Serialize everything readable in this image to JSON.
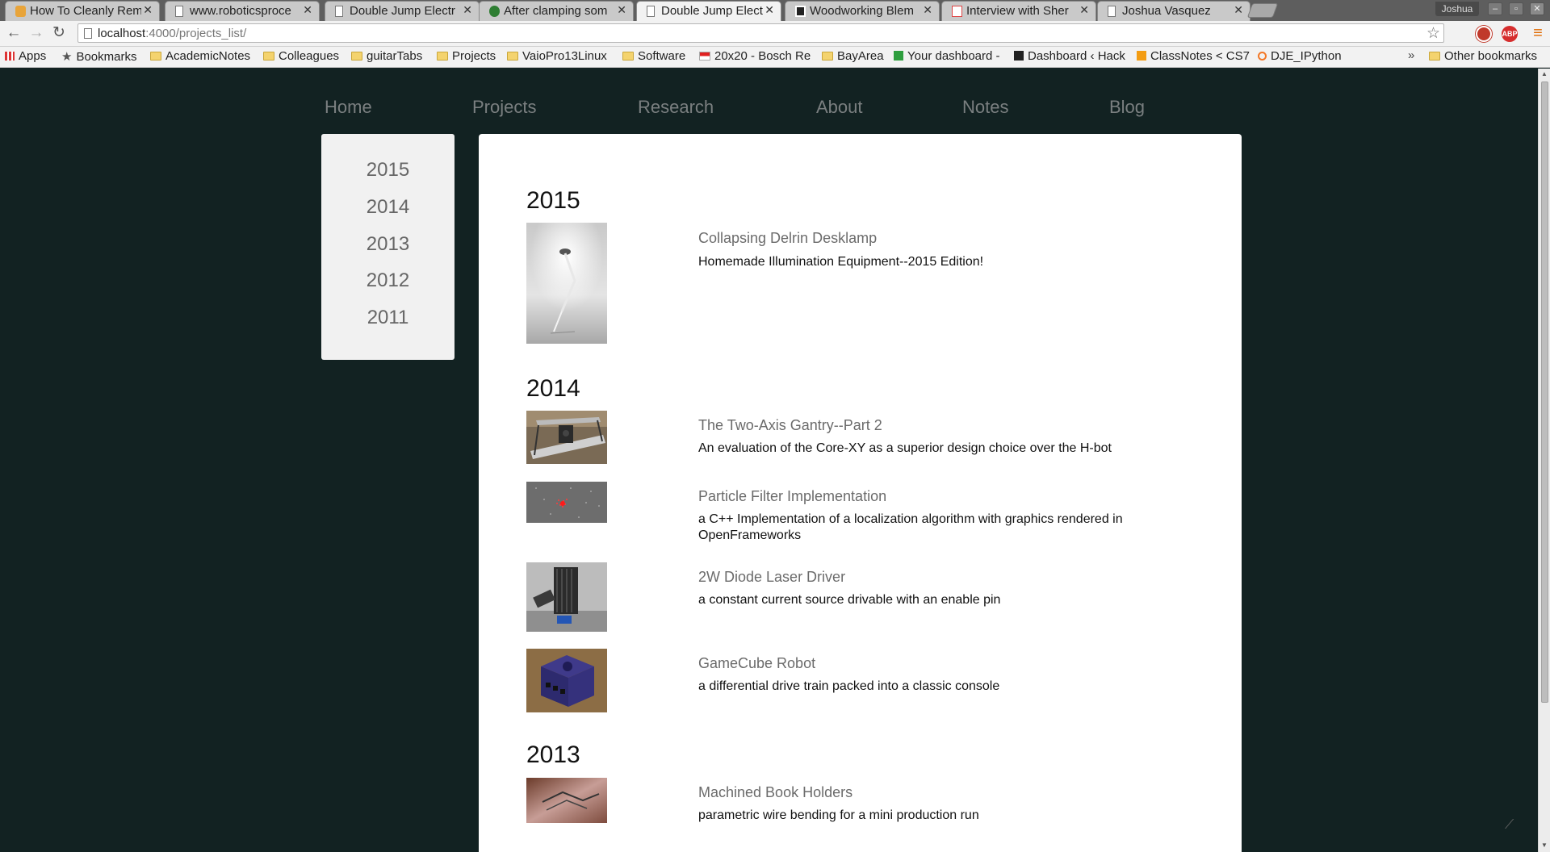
{
  "browser": {
    "tabs": [
      {
        "title": "How To Cleanly Rem",
        "favicon": "ubuntu-icon"
      },
      {
        "title": "www.roboticsproce",
        "favicon": "page-icon"
      },
      {
        "title": "Double Jump Electr",
        "favicon": "page-icon"
      },
      {
        "title": "After clamping som",
        "favicon": "green-circle-icon"
      },
      {
        "title": "Double Jump Electr",
        "favicon": "page-icon"
      },
      {
        "title": "Woodworking Blem",
        "favicon": "hackaday-icon"
      },
      {
        "title": "Interview with Sher",
        "favicon": "gmail-icon"
      },
      {
        "title": "Joshua Vasquez",
        "favicon": "page-icon"
      }
    ],
    "profile_name": "Joshua",
    "url_host": "localhost",
    "url_rest": ":4000/projects_list/",
    "bookmarks": [
      {
        "label": "Apps",
        "icon": "apps-icon"
      },
      {
        "label": "Bookmarks",
        "icon": "star-icon"
      },
      {
        "label": "AcademicNotes",
        "icon": "folder-icon"
      },
      {
        "label": "Colleagues",
        "icon": "folder-icon"
      },
      {
        "label": "guitarTabs",
        "icon": "folder-icon"
      },
      {
        "label": "Projects",
        "icon": "folder-icon"
      },
      {
        "label": "VaioPro13Linux",
        "icon": "folder-icon"
      },
      {
        "label": "Software",
        "icon": "folder-icon"
      },
      {
        "label": "20x20 - Bosch Re",
        "icon": "flag-icon"
      },
      {
        "label": "BayArea",
        "icon": "folder-icon"
      },
      {
        "label": "Your dashboard -",
        "icon": "plus-icon"
      },
      {
        "label": "Dashboard ‹ Hack",
        "icon": "hackaday-icon"
      },
      {
        "label": "ClassNotes < CS7",
        "icon": "orange-icon"
      },
      {
        "label": "DJE_IPython",
        "icon": "jupyter-icon"
      }
    ],
    "other_bookmarks": "Other bookmarks",
    "more_chevron": "»"
  },
  "site": {
    "nav": [
      "Home",
      "Projects",
      "Research",
      "About",
      "Notes",
      "Blog"
    ],
    "year_links": [
      "2015",
      "2014",
      "2013",
      "2012",
      "2011"
    ],
    "sections": [
      {
        "year": "2015",
        "projects": [
          {
            "title": "Collapsing Delrin Desklamp",
            "desc": "Homemade Illumination Equipment--2015 Edition!",
            "thumb": "desklamp"
          }
        ]
      },
      {
        "year": "2014",
        "projects": [
          {
            "title": "The Two-Axis Gantry--Part 2",
            "desc": "An evaluation of the Core-XY as a superior design choice over the H-bot",
            "thumb": "gantry"
          },
          {
            "title": "Particle Filter Implementation",
            "desc": "a C++ Implementation of a localization algorithm with graphics rendered in OpenFrameworks",
            "thumb": "particle"
          },
          {
            "title": "2W Diode Laser Driver",
            "desc": "a constant current source drivable with an enable pin",
            "thumb": "laser"
          },
          {
            "title": "GameCube Robot",
            "desc": "a differential drive train packed into a classic console",
            "thumb": "gamecube"
          }
        ]
      },
      {
        "year": "2013",
        "projects": [
          {
            "title": "Machined Book Holders",
            "desc": "parametric wire bending for a mini production run",
            "thumb": "bookholder"
          }
        ]
      }
    ]
  }
}
